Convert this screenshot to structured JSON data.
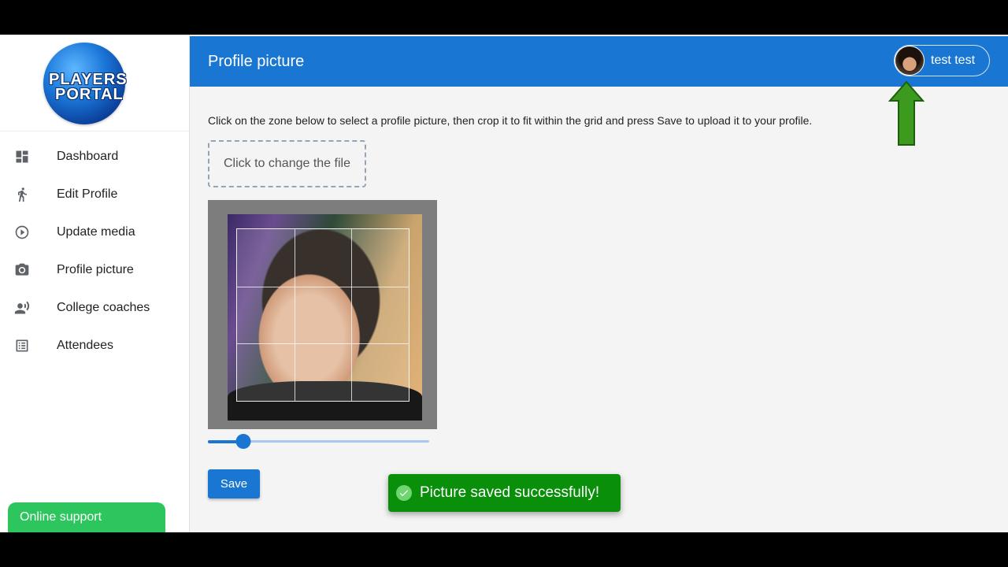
{
  "brand": {
    "line1": "PLAYERS",
    "line2": "PORTAL"
  },
  "sidebar": {
    "items": [
      {
        "label": "Dashboard",
        "icon": "dashboard-icon"
      },
      {
        "label": "Edit Profile",
        "icon": "running-person-icon"
      },
      {
        "label": "Update media",
        "icon": "play-circle-icon"
      },
      {
        "label": "Profile picture",
        "icon": "camera-icon"
      },
      {
        "label": "College coaches",
        "icon": "record-voice-icon"
      },
      {
        "label": "Attendees",
        "icon": "list-icon"
      }
    ],
    "support_label": "Online support"
  },
  "header": {
    "title": "Profile picture",
    "user_name": "test test"
  },
  "main": {
    "instructions": "Click on the zone below to select a profile picture, then crop it to fit within the grid and press Save to upload it to your profile.",
    "file_zone_label": "Click to change the file",
    "zoom_level": 0.16,
    "save_label": "Save"
  },
  "toast": {
    "message": "Picture saved successfully!"
  },
  "colors": {
    "primary": "#1976d2",
    "support": "#2cc55e",
    "toast": "#0a8f0a",
    "arrow": "#3c9a1e"
  }
}
